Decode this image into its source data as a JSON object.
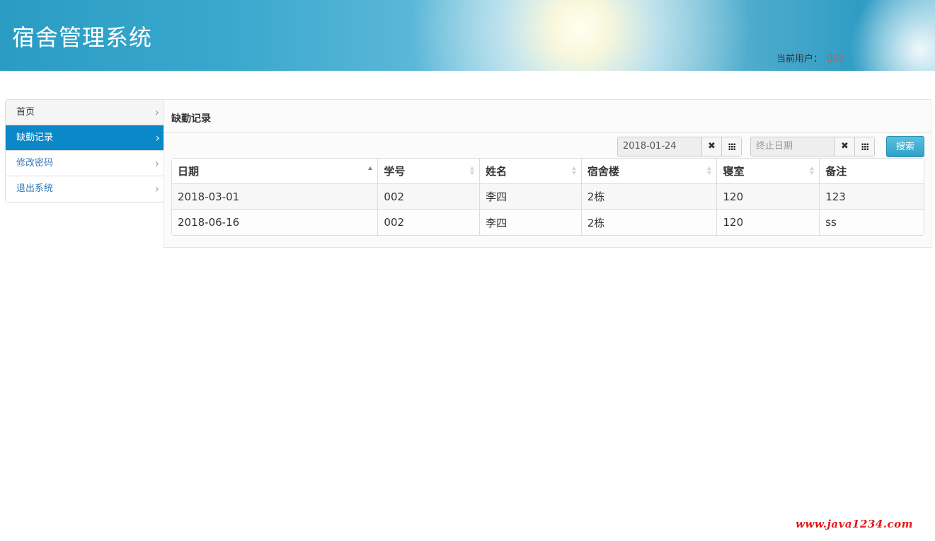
{
  "header": {
    "title": "宿舍管理系统",
    "user_label": "当前用户：",
    "user_id": "002"
  },
  "sidebar": {
    "items": [
      {
        "label": "首页",
        "icon": "chevron-right-icon"
      },
      {
        "label": "缺勤记录",
        "icon": "chevron-right-icon",
        "active": true
      },
      {
        "label": "修改密码",
        "icon": "chevron-right-icon"
      },
      {
        "label": "退出系统",
        "icon": "chevron-right-icon"
      }
    ]
  },
  "main": {
    "title": "缺勤记录",
    "start_date": {
      "value": "2018-01-24",
      "placeholder": "",
      "clear_icon": "close-icon",
      "picker_icon": "grid-icon"
    },
    "end_date": {
      "value": "",
      "placeholder": "终止日期",
      "clear_icon": "close-icon",
      "picker_icon": "grid-icon"
    },
    "search_label": "搜索",
    "table": {
      "columns": [
        "日期",
        "学号",
        "姓名",
        "宿舍楼",
        "寝室",
        "备注"
      ],
      "sorted_column": "日期",
      "sort_direction": "asc",
      "rows": [
        [
          "2018-03-01",
          "002",
          "李四",
          "2栋",
          "120",
          "123"
        ],
        [
          "2018-06-16",
          "002",
          "李四",
          "2栋",
          "120",
          "ss"
        ]
      ]
    }
  },
  "watermark": "www.java1234.com",
  "colors": {
    "accent": "#0a88c8",
    "user_id": "#d9534f",
    "watermark": "#e01818"
  }
}
